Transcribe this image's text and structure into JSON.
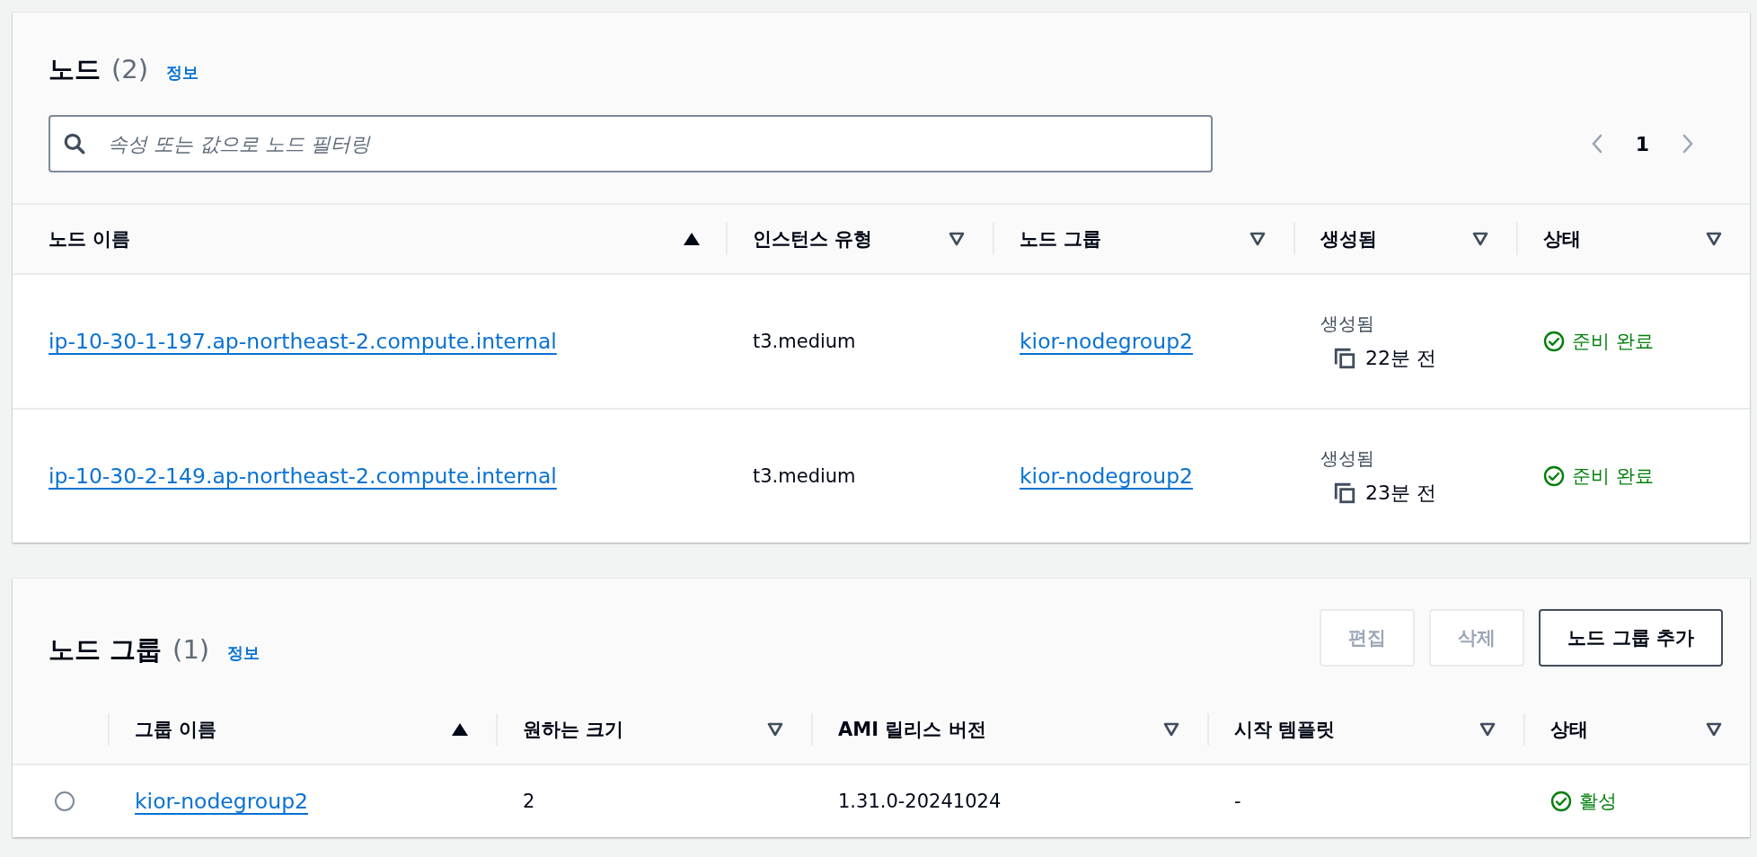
{
  "nodes": {
    "title": "노드",
    "count": "(2)",
    "info_link": "정보",
    "search": {
      "placeholder": "속성 또는 값으로 노드 필터링"
    },
    "pagination": {
      "page": "1",
      "prev_disabled": true,
      "next_disabled": true
    },
    "columns": [
      {
        "label": "노드 이름",
        "sorted": true
      },
      {
        "label": "인스턴스 유형",
        "sorted": false
      },
      {
        "label": "노드 그룹",
        "sorted": false
      },
      {
        "label": "생성됨",
        "sorted": false
      },
      {
        "label": "상태",
        "sorted": false
      }
    ],
    "rows": [
      {
        "name": "ip-10-30-1-197.ap-northeast-2.compute.internal",
        "instance_type": "t3.medium",
        "node_group": "kior-nodegroup2",
        "created_label": "생성됨",
        "created_time": "22분 전",
        "status": {
          "kind": "ok",
          "label": "준비 완료"
        }
      },
      {
        "name": "ip-10-30-2-149.ap-northeast-2.compute.internal",
        "instance_type": "t3.medium",
        "node_group": "kior-nodegroup2",
        "created_label": "생성됨",
        "created_time": "23분 전",
        "status": {
          "kind": "ok",
          "label": "준비 완료"
        }
      }
    ]
  },
  "node_groups": {
    "title": "노드 그룹",
    "count": "(1)",
    "info_link": "정보",
    "buttons": [
      {
        "label": "편집",
        "disabled": true
      },
      {
        "label": "삭제",
        "disabled": true
      },
      {
        "label": "노드 그룹 추가",
        "disabled": false
      }
    ],
    "columns": [
      {
        "label": "그룹 이름",
        "sorted": true
      },
      {
        "label": "원하는 크기",
        "sorted": false
      },
      {
        "label": "AMI 릴리스 버전",
        "sorted": false
      },
      {
        "label": "시작 템플릿",
        "sorted": false
      },
      {
        "label": "상태",
        "sorted": false
      }
    ],
    "rows": [
      {
        "selected": false,
        "name": "kior-nodegroup2",
        "desired_size": "2",
        "ami_version": "1.31.0-20241024",
        "launch_template": "-",
        "status": {
          "kind": "ok",
          "label": "활성"
        }
      }
    ]
  }
}
